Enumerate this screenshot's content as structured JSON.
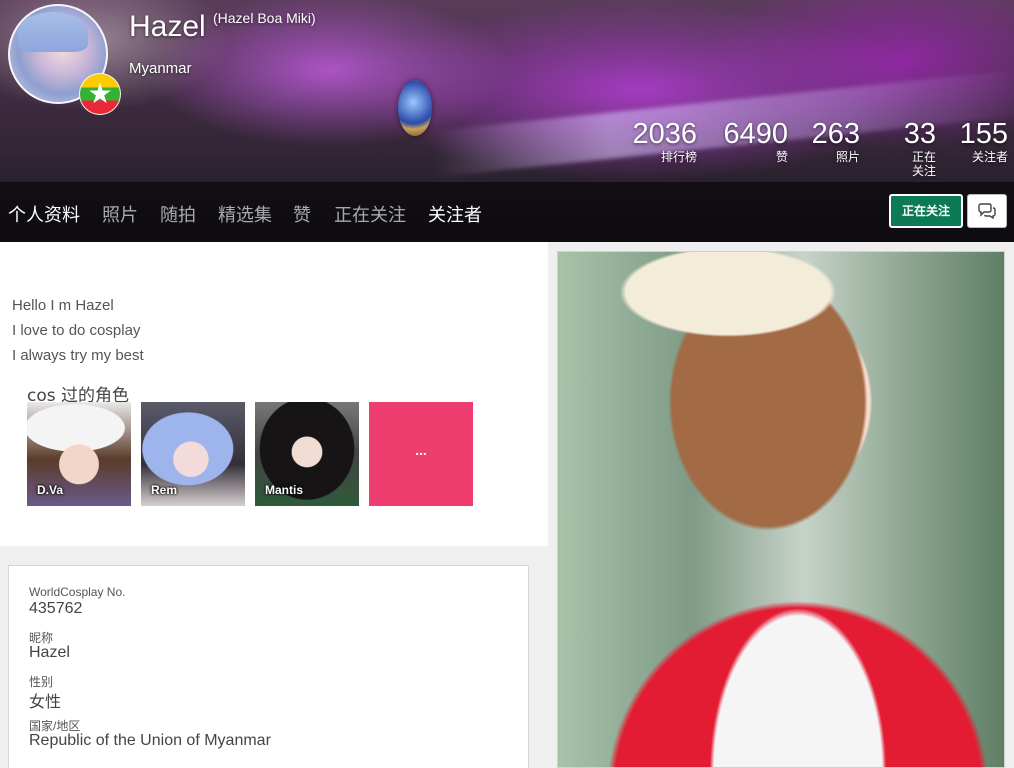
{
  "profile": {
    "name": "Hazel",
    "alt_name": "(Hazel Boa Miki)",
    "country": "Myanmar"
  },
  "stats": [
    {
      "value": "2036",
      "label": "排行榜"
    },
    {
      "value": "6490",
      "label": "赞"
    },
    {
      "value": "263",
      "label": "照片"
    },
    {
      "value": "33",
      "label": "正在关注"
    },
    {
      "value": "155",
      "label": "关注者"
    }
  ],
  "nav": {
    "tabs": [
      "个人资料",
      "照片",
      "随拍",
      "精选集",
      "赞",
      "正在关注",
      "关注者"
    ],
    "active": [
      "个人资料",
      "关注者"
    ]
  },
  "actions": {
    "follow_label": "正在关注"
  },
  "bio": {
    "lines": [
      "Hello I m Hazel",
      "I love to do cosplay",
      "I always try my best"
    ]
  },
  "roles": {
    "title": "cos 过的角色",
    "items": [
      "D.Va",
      "Rem",
      "Mantis"
    ],
    "more_label": "..."
  },
  "info": [
    {
      "label": "WorldCosplay No.",
      "value": "435762"
    },
    {
      "label": "昵称",
      "value": "Hazel"
    },
    {
      "label": "性别",
      "value": "女性"
    },
    {
      "label": "国家/地区",
      "value": "Republic of the Union of Myanmar"
    }
  ],
  "colors": {
    "follow_button": "#0b7a55",
    "more_tile": "#ee3d6f",
    "nav_active": "#ffffff",
    "nav_inactive": "#a9a9a9"
  },
  "icons": {
    "message": "chat-bubbles-icon",
    "flag": "myanmar-flag-icon"
  }
}
